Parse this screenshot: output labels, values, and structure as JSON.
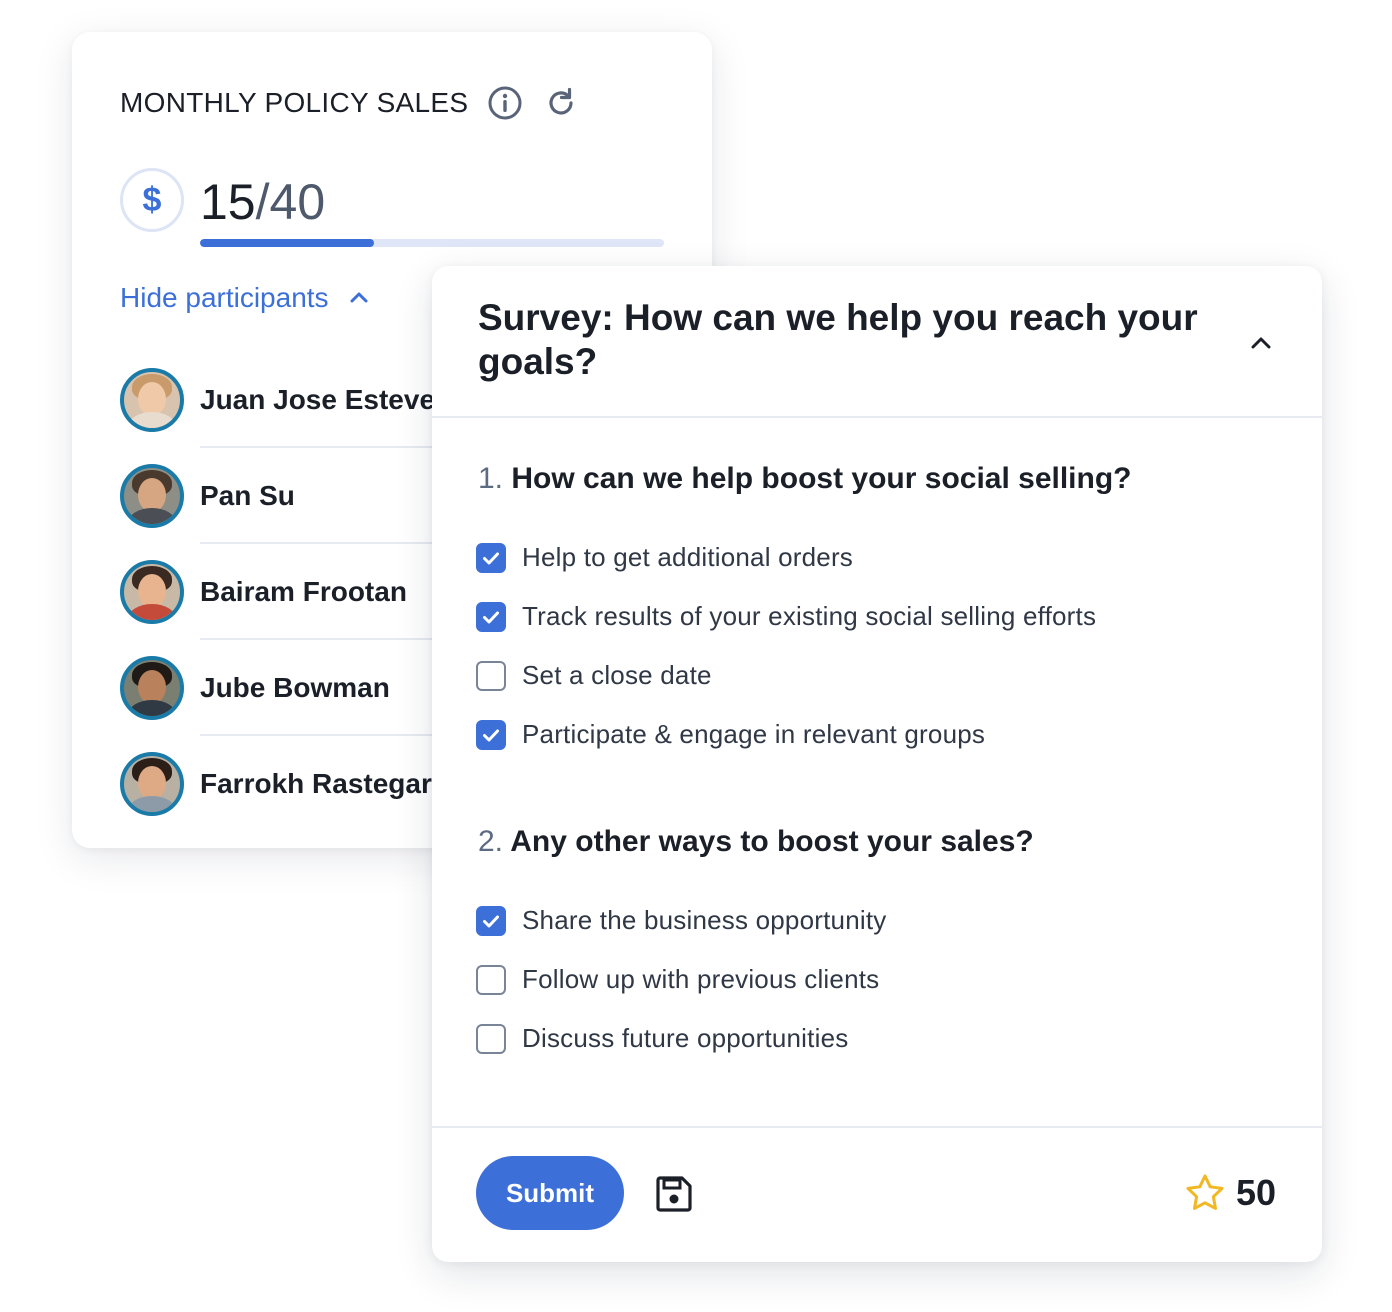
{
  "sales_card": {
    "title": "MONTHLY POLICY SALES",
    "icons": {
      "info": "info-icon",
      "refresh": "refresh-icon",
      "currency": "dollar-icon"
    },
    "currency_symbol": "$",
    "progress": {
      "current": "15",
      "separator": "/",
      "total": "40",
      "fraction": 0.375
    },
    "hide_label": "Hide participants",
    "participants": [
      {
        "name": "Juan Jose Esteve"
      },
      {
        "name": "Pan Su"
      },
      {
        "name": "Bairam Frootan"
      },
      {
        "name": "Jube Bowman"
      },
      {
        "name": "Farrokh Rastegar"
      }
    ]
  },
  "survey": {
    "title": "Survey: How can we help you reach your goals?",
    "questions": [
      {
        "number": "1.",
        "text": "How can we help boost your social selling?",
        "options": [
          {
            "label": "Help to get additional orders",
            "checked": true
          },
          {
            "label": "Track results of your existing social selling efforts",
            "checked": true
          },
          {
            "label": "Set a close date",
            "checked": false
          },
          {
            "label": "Participate & engage in relevant groups",
            "checked": true
          }
        ]
      },
      {
        "number": "2.",
        "text": "Any other ways to boost your sales?",
        "options": [
          {
            "label": "Share the business opportunity",
            "checked": true
          },
          {
            "label": "Follow up with previous clients",
            "checked": false
          },
          {
            "label": "Discuss future opportunities",
            "checked": false
          }
        ]
      }
    ],
    "submit_label": "Submit",
    "points": "50"
  },
  "colors": {
    "accent": "#3c6fd7",
    "avatar_ring": "#1a7ba8",
    "star": "#f2b824",
    "text": "#1b1f27"
  }
}
